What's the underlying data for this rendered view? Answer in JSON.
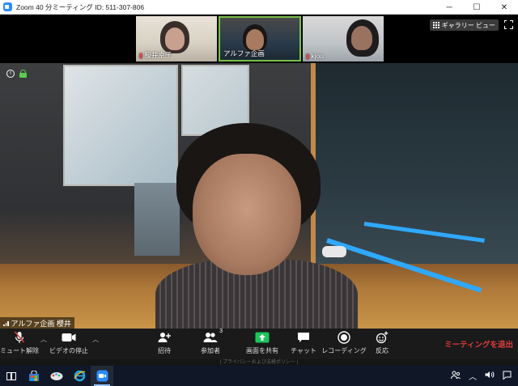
{
  "window": {
    "title": "Zoom 40 分ミーティング ID: 511-307-806",
    "minimize": "─",
    "maximize": "☐",
    "close": "✕"
  },
  "gallery_view": {
    "label": "ギャラリー ビュー"
  },
  "thumbnails": [
    {
      "name": "桜井幸子"
    },
    {
      "name": "アルファ企画"
    },
    {
      "name": "kjou"
    }
  ],
  "speaker": {
    "name": "アルファ企画 櫻井"
  },
  "toolbar": {
    "mute": "ミュート解除",
    "video": "ビデオの停止",
    "invite": "招待",
    "participants": "参加者",
    "participants_count": "3",
    "share": "画面を共有",
    "chat": "チャット",
    "record": "レコーディング",
    "reactions": "反応",
    "leave": "ミーティングを退出"
  },
  "privacy_text": "| プライバシーおよび法務ポリシー |",
  "colors": {
    "accent": "#2d8cff",
    "share_green": "#1ec45a",
    "leave_red": "#e03c3c",
    "active_speaker_border": "#79c04a"
  }
}
